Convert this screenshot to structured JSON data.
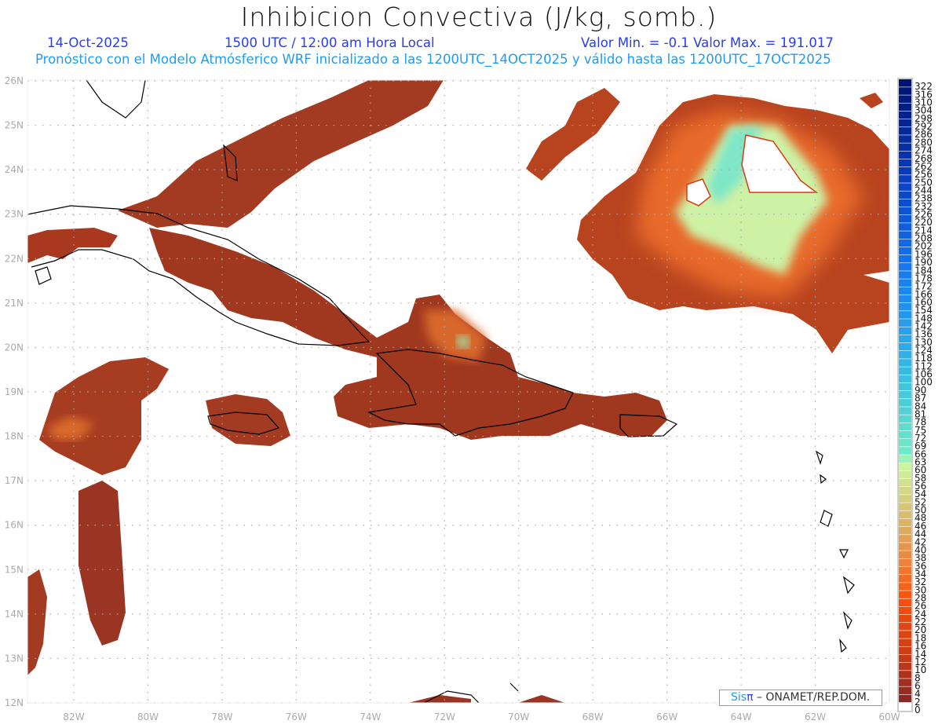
{
  "header": {
    "title": "Inhibicion Convectiva (J/kg, somb.)",
    "date": "14-Oct-2025",
    "time": "1500 UTC / 12:00 am Hora Local",
    "minmax": "Valor Min. = -0.1  Valor Max. = 191.017",
    "description": "Pronóstico con el Modelo Atmósferico WRF inicializado a las 1200UTC_14OCT2025 y válido hasta las  1200UTC_17OCT2025"
  },
  "axes": {
    "lat_labels": [
      "26N",
      "25N",
      "24N",
      "23N",
      "22N",
      "21N",
      "20N",
      "19N",
      "18N",
      "17N",
      "16N",
      "15N",
      "14N",
      "13N",
      "12N"
    ],
    "lon_labels": [
      "82W",
      "80W",
      "78W",
      "76W",
      "74W",
      "72W",
      "70W",
      "68W",
      "66W",
      "64W",
      "62W",
      "60W"
    ]
  },
  "colorbar": {
    "labels": [
      "322",
      "316",
      "310",
      "304",
      "298",
      "292",
      "286",
      "280",
      "274",
      "268",
      "262",
      "256",
      "250",
      "244",
      "238",
      "232",
      "226",
      "220",
      "214",
      "208",
      "202",
      "196",
      "190",
      "184",
      "178",
      "172",
      "166",
      "160",
      "154",
      "148",
      "142",
      "136",
      "130",
      "124",
      "118",
      "112",
      "106",
      "100",
      "90",
      "87",
      "84",
      "81",
      "78",
      "75",
      "72",
      "69",
      "66",
      "63",
      "60",
      "58",
      "56",
      "54",
      "52",
      "50",
      "48",
      "46",
      "44",
      "42",
      "40",
      "38",
      "36",
      "34",
      "32",
      "30",
      "28",
      "26",
      "24",
      "22",
      "20",
      "18",
      "16",
      "14",
      "12",
      "10",
      "8",
      "6",
      "4",
      "2",
      "0"
    ]
  },
  "credit": {
    "logo_text": "Sis",
    "logo_pi": "π",
    "org": " –  ONAMET/REP.DOM."
  }
}
